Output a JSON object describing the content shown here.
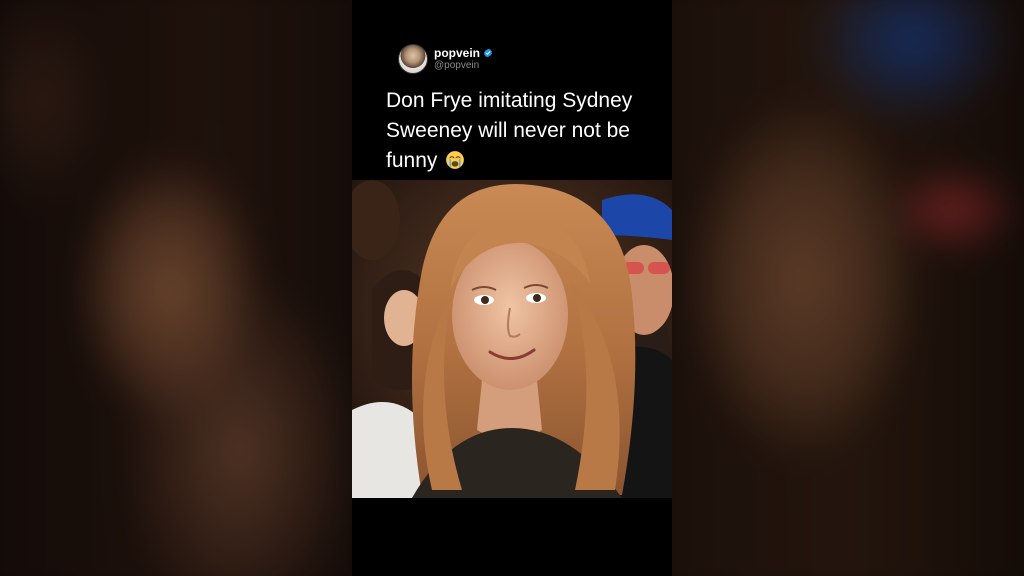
{
  "tweet": {
    "display_name": "popvein",
    "handle": "@popvein",
    "verified": true,
    "text": "Don Frye imitating Sydney Sweeney will never not be funny",
    "emoji": "loudly-crying-face-icon"
  },
  "colors": {
    "background": "#000000",
    "text": "#ffffff",
    "handle_text": "#8b8b8b",
    "verified_badge": "#1d9bf0",
    "emoji_yellow": "#ffcc4d",
    "emoji_tears": "#5dadec"
  }
}
